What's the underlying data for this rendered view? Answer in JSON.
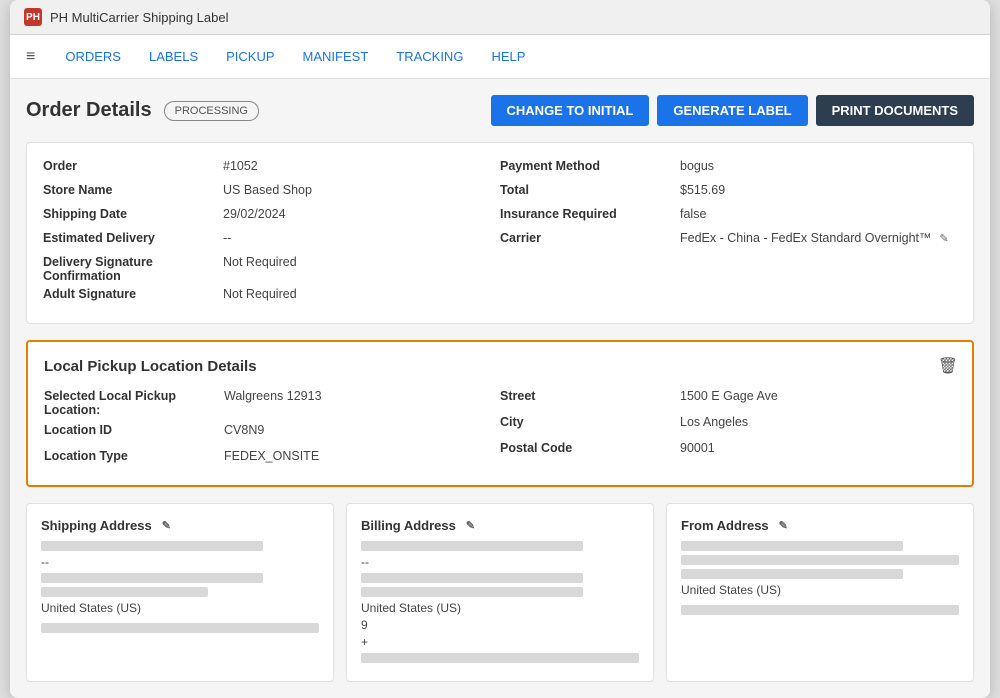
{
  "window": {
    "title": "PH MultiCarrier Shipping Label"
  },
  "nav": {
    "menu_icon": "≡",
    "items": [
      "ORDERS",
      "LABELS",
      "PICKUP",
      "MANIFEST",
      "TRACKING",
      "HELP"
    ]
  },
  "header": {
    "title": "Order Details",
    "status": "PROCESSING",
    "buttons": {
      "change": "CHANGE TO INITIAL",
      "generate": "GENERATE LABEL",
      "print": "PRINT DOCUMENTS"
    }
  },
  "order_details": {
    "left": [
      {
        "label": "Order",
        "value": "#1052"
      },
      {
        "label": "Store Name",
        "value": "US Based Shop"
      },
      {
        "label": "Shipping Date",
        "value": "29/02/2024"
      },
      {
        "label": "Estimated Delivery",
        "value": "--"
      },
      {
        "label": "Delivery Signature Confirmation",
        "value": "Not Required"
      },
      {
        "label": "Adult Signature",
        "value": "Not Required"
      }
    ],
    "right": [
      {
        "label": "Payment Method",
        "value": "bogus"
      },
      {
        "label": "Total",
        "value": "$515.69"
      },
      {
        "label": "Insurance Required",
        "value": "false"
      },
      {
        "label": "Carrier",
        "value": "FedEx - China - FedEx Standard Overnight™"
      }
    ]
  },
  "pickup": {
    "title": "Local Pickup Location Details",
    "left": [
      {
        "label": "Selected Local Pickup Location:",
        "value": "Walgreens 12913"
      },
      {
        "label": "Location ID",
        "value": "CV8N9"
      },
      {
        "label": "Location Type",
        "value": "FEDEX_ONSITE"
      }
    ],
    "right": [
      {
        "label": "Street",
        "value": "1500 E Gage Ave"
      },
      {
        "label": "City",
        "value": "Los Angeles"
      },
      {
        "label": "Postal Code",
        "value": "90001"
      }
    ],
    "trash_icon": "🗑"
  },
  "addresses": {
    "shipping": {
      "title": "Shipping Address",
      "country": "United States (US)"
    },
    "billing": {
      "title": "Billing Address",
      "country": "United States (US)",
      "extra1": "9",
      "extra2": "+"
    },
    "from": {
      "title": "From Address",
      "country": "United States (US)"
    }
  }
}
